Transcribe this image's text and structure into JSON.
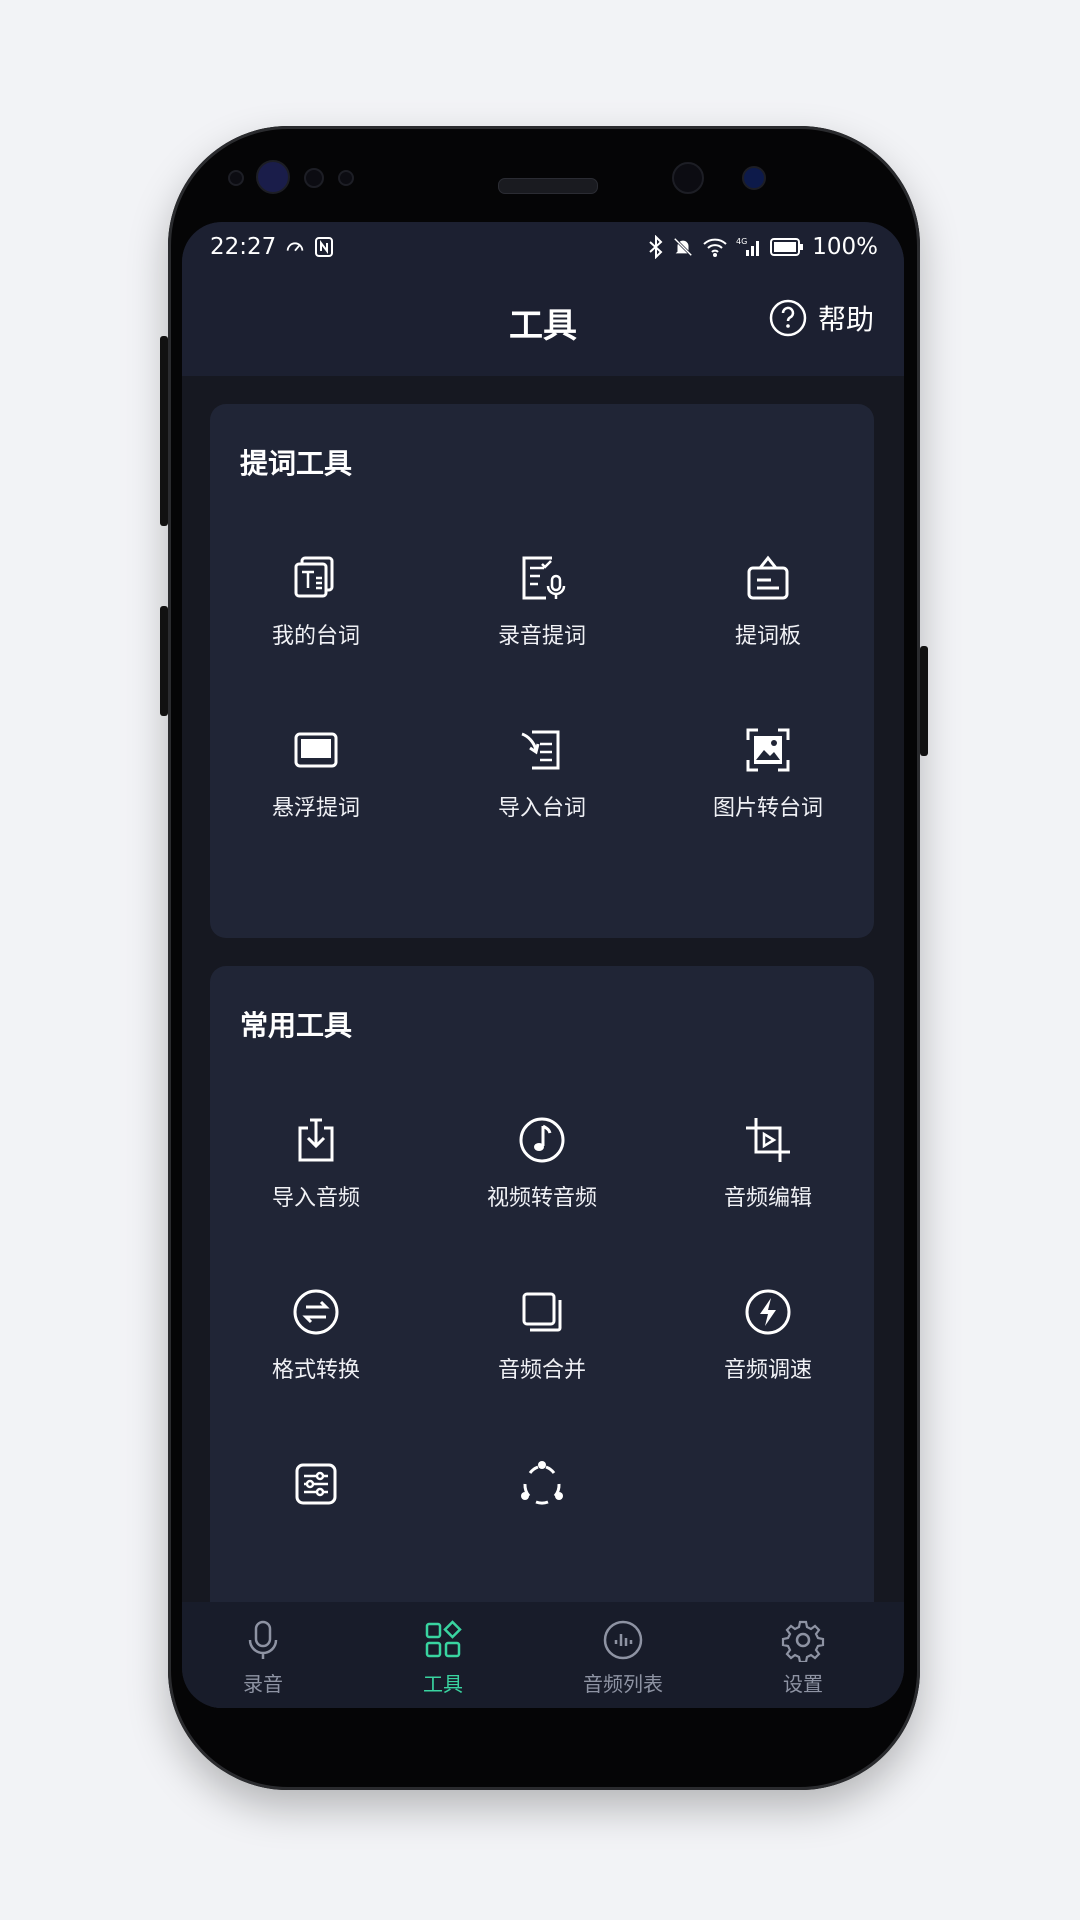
{
  "status_bar": {
    "time": "22:27",
    "battery": "100%",
    "network": "4G"
  },
  "app_bar": {
    "title": "工具",
    "help_label": "帮助"
  },
  "sections": [
    {
      "title": "提词工具",
      "items": [
        {
          "label": "我的台词",
          "icon": "script-document-icon"
        },
        {
          "label": "录音提词",
          "icon": "record-script-icon"
        },
        {
          "label": "提词板",
          "icon": "prompter-board-icon"
        },
        {
          "label": "悬浮提词",
          "icon": "floating-window-icon"
        },
        {
          "label": "导入台词",
          "icon": "import-script-icon"
        },
        {
          "label": "图片转台词",
          "icon": "image-to-text-icon"
        }
      ]
    },
    {
      "title": "常用工具",
      "items": [
        {
          "label": "导入音频",
          "icon": "import-audio-icon"
        },
        {
          "label": "视频转音频",
          "icon": "music-note-icon"
        },
        {
          "label": "音频编辑",
          "icon": "crop-play-icon"
        },
        {
          "label": "格式转换",
          "icon": "swap-arrows-icon"
        },
        {
          "label": "音频合并",
          "icon": "merge-squares-icon"
        },
        {
          "label": "音频调速",
          "icon": "lightning-icon"
        }
      ]
    }
  ],
  "bottom_nav": [
    {
      "label": "录音",
      "icon": "microphone-icon",
      "active": false
    },
    {
      "label": "工具",
      "icon": "grid-tools-icon",
      "active": true
    },
    {
      "label": "音频列表",
      "icon": "audio-list-icon",
      "active": false
    },
    {
      "label": "设置",
      "icon": "gear-icon",
      "active": false
    }
  ],
  "colors": {
    "accent": "#39d4a0",
    "background": "#161821",
    "card": "#202536",
    "header": "#1c2031"
  }
}
